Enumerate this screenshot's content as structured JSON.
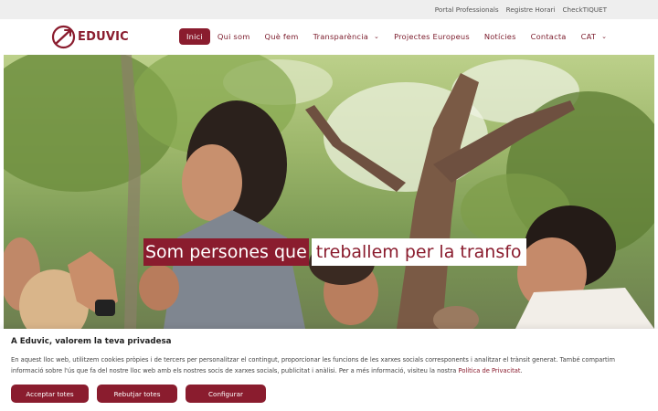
{
  "topbar": {
    "links": [
      "Portal Professionals",
      "Registre Horari",
      "CheckTIQUET"
    ]
  },
  "header": {
    "logo_text": "EDUVIC",
    "nav": [
      {
        "label": "Inici",
        "active": true,
        "dropdown": false
      },
      {
        "label": "Qui som",
        "active": false,
        "dropdown": false
      },
      {
        "label": "Què fem",
        "active": false,
        "dropdown": false
      },
      {
        "label": "Transparència",
        "active": false,
        "dropdown": true
      },
      {
        "label": "Projectes Europeus",
        "active": false,
        "dropdown": false
      },
      {
        "label": "Notícies",
        "active": false,
        "dropdown": false
      },
      {
        "label": "Contacta",
        "active": false,
        "dropdown": false
      },
      {
        "label": "CAT",
        "active": false,
        "dropdown": true
      }
    ]
  },
  "hero": {
    "text_part1": "Som persones que",
    "text_part2": "treballem per la transfo"
  },
  "cookie": {
    "title": "A Eduvic, valorem la teva privadesa",
    "body": "En aquest lloc web, utilitzem cookies pròpies i de tercers per personalitzar el contingut, proporcionar les funcions de les xarxes socials corresponents i analitzar el trànsit generat. També compartim informació sobre l'ús que fa del nostre lloc web amb els nostres socis de xarxes socials, publicitat i anàlisi. Per a més informació, visiteu la nostra",
    "link": "Política de Privacitat",
    "body_end": ".",
    "buttons": {
      "accept": "Acceptar totes",
      "reject": "Rebutjar totes",
      "configure": "Configurar"
    }
  },
  "colors": {
    "brand": "#8a1c2e",
    "topbar_bg": "#eeeeee"
  },
  "icons": {
    "logo": "eduvic-logo-icon",
    "dropdown": "chevron-down-icon"
  }
}
